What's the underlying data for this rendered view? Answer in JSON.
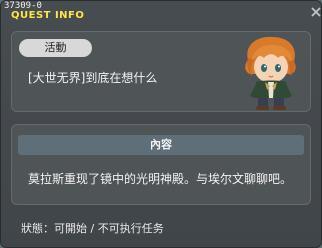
{
  "window": {
    "id_line": "37309-0",
    "title": "QUEST INFO"
  },
  "quest": {
    "tag": "活動",
    "name": "[大世无界]到底在想什么"
  },
  "content": {
    "header": "內容",
    "text": "莫拉斯重现了镜中的光明神殿。与埃尔文聊聊吧。"
  },
  "status": {
    "text": "狀態：可開始 / 不可执行任务"
  },
  "colors": {
    "title": "#ffe44a",
    "tag_bg": "#d8d8d8",
    "header_bg": "#5f6f7a"
  },
  "icons": [
    "close-icon",
    "npc-character-avatar"
  ]
}
